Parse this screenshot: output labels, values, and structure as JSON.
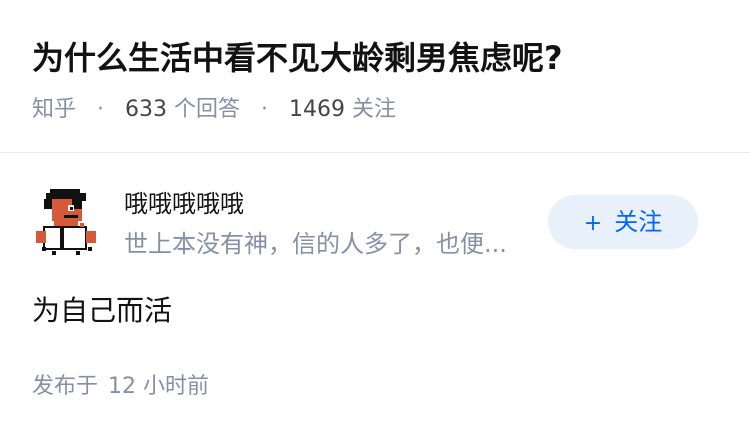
{
  "question": {
    "title": "为什么生活中看不见大龄剩男焦虑呢?",
    "source": "知乎",
    "separator": "·",
    "answer_count": "633",
    "answer_label": "个回答",
    "follower_count": "1469",
    "follower_label": "关注"
  },
  "answer": {
    "author": {
      "name": "哦哦哦哦哦",
      "bio": "世上本没有神，信的人多了，也便...",
      "avatar_icon": "pixel-character-avatar"
    },
    "follow_button": {
      "icon": "+",
      "label": "关注"
    },
    "content": "为自己而活",
    "published_label": "发布于",
    "published_time": "12 小时前"
  },
  "colors": {
    "title_text": "#121212",
    "meta_text": "#8590a6",
    "accent_blue": "#0066ff",
    "follow_button_bg": "#e8f1fb",
    "divider": "#ececec"
  }
}
